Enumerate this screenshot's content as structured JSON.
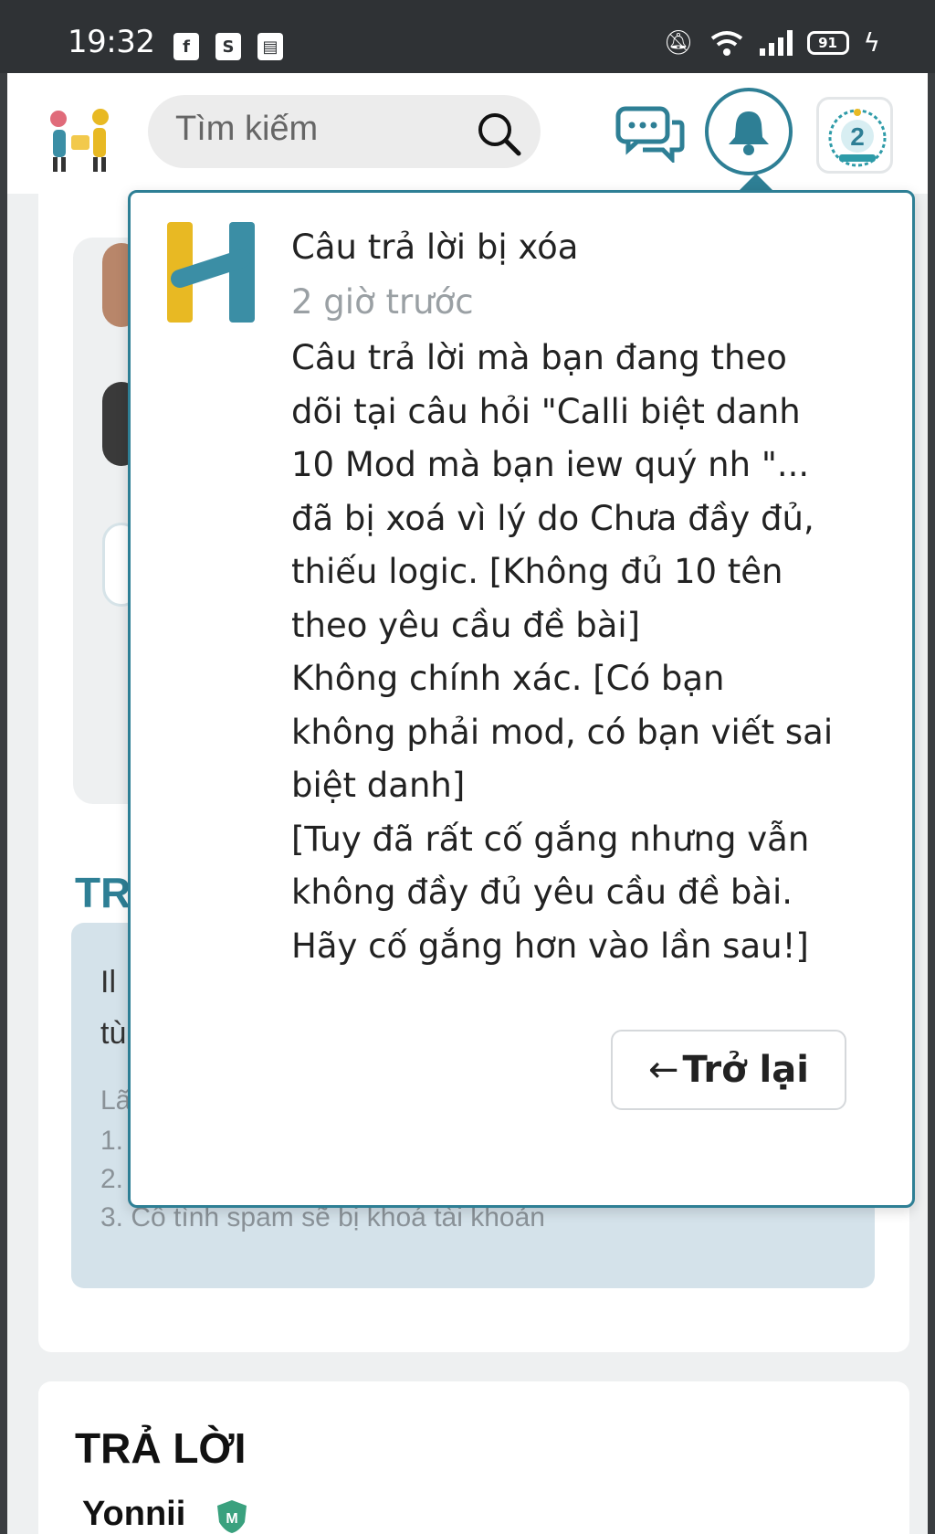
{
  "status_bar": {
    "time": "19:32",
    "battery": "91"
  },
  "header": {
    "search_placeholder": "Tìm kiếm"
  },
  "background": {
    "section_title_partial": "TR",
    "rules_line1_partial": "Il",
    "rules_line2_partial": "tù",
    "rules_label_partial": "Lã",
    "rule1_partial": "1.",
    "rule2_partial": "2.",
    "rule3": "3. Cố tình spam sẽ bị khoá tài khoản",
    "answers_title": "TRẢ LỜI",
    "answer_user": "Yonnii",
    "mod_badge": "M"
  },
  "notification": {
    "title": "Câu trả lời bị xóa",
    "time": "2 giờ trước",
    "body_lines": [
      "Câu trả lời mà bạn đang theo",
      "dõi tại câu hỏi \"Calli biệt danh",
      "10 Mod mà bạn iew quý nh \"...",
      "đã bị xoá vì lý do Chưa đầy đủ,",
      "thiếu logic. [Không đủ 10 tên",
      "theo yêu cầu đề bài]",
      "Không chính xác. [Có bạn",
      "không phải mod, có bạn viết sai",
      "biệt danh]",
      "[Tuy đã rất cố gắng nhưng vẫn",
      "không đầy đủ yêu cầu đề bài.",
      "Hãy cố gắng hơn vào lần sau!]"
    ],
    "back_button": "Trở lại",
    "back_arrow": "←"
  },
  "colors": {
    "accent": "#2e7f95",
    "logo_yellow": "#e8b923",
    "logo_teal": "#3b8ea5"
  }
}
